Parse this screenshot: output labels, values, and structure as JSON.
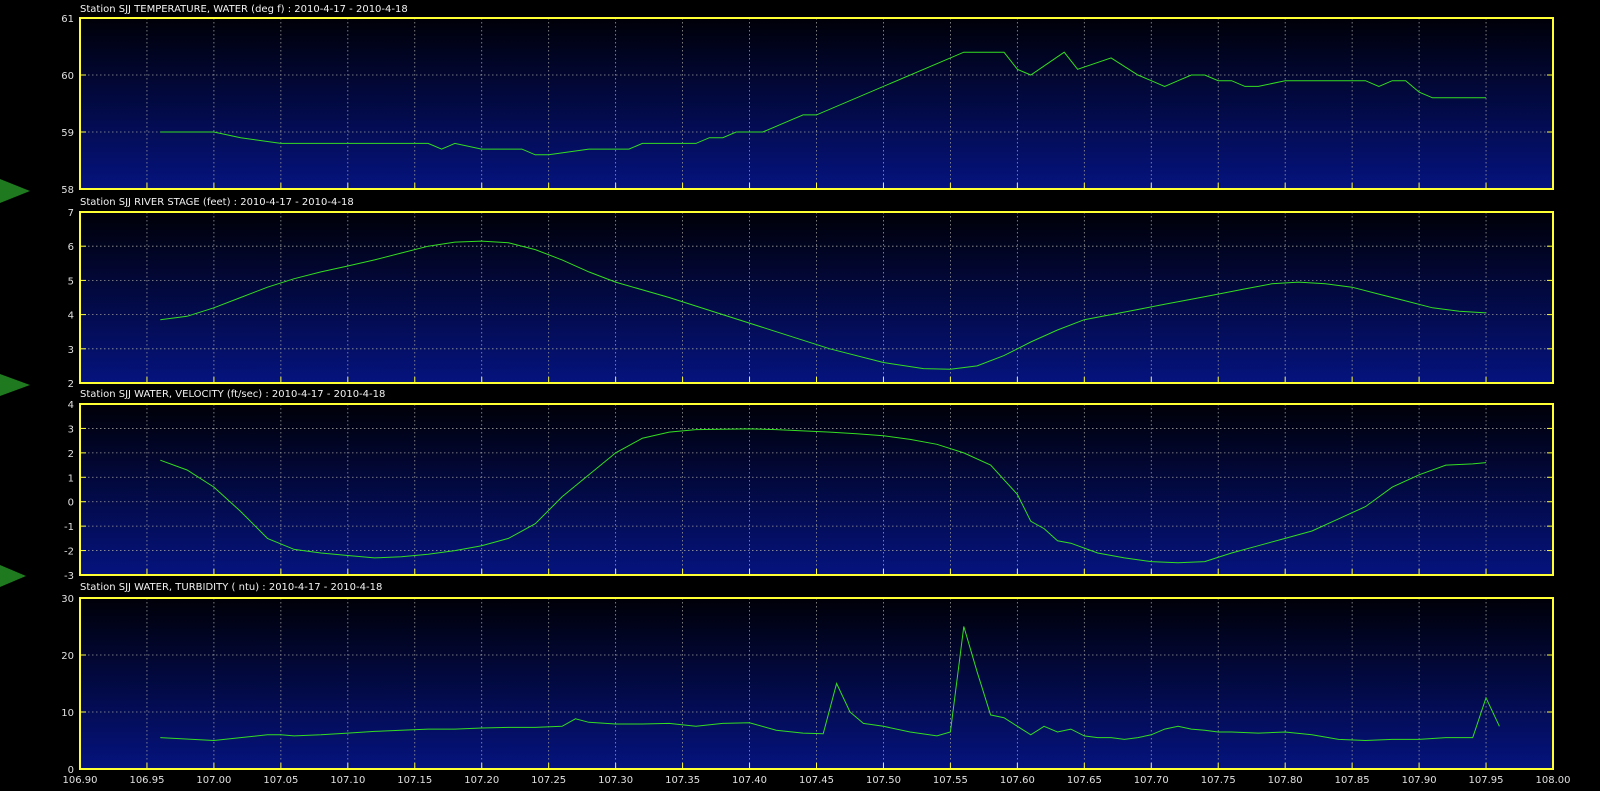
{
  "colors": {
    "background": "#000000",
    "frame": "#ffff33",
    "series": "#33dd22",
    "grid": "#9a9a9a",
    "gradient_top": "#000008",
    "gradient_bottom": "#05137e",
    "marker": "#1f7a1f"
  },
  "chart_data": [
    {
      "type": "line",
      "title": "Station SJJ TEMPERATURE, WATER (deg f) : 2010-4-17 - 2010-4-18",
      "xlim": [
        106.9,
        108.0
      ],
      "ylim": [
        58,
        61
      ],
      "yticks": [
        "58",
        "59",
        "60",
        "61"
      ],
      "grid": true,
      "series": [
        {
          "x": [
            106.96,
            107.0,
            107.02,
            107.05,
            107.1,
            107.15,
            107.16,
            107.17,
            107.175,
            107.18,
            107.2,
            107.22,
            107.23,
            107.24,
            107.25,
            107.28,
            107.3,
            107.31,
            107.32,
            107.35,
            107.36,
            107.37,
            107.38,
            107.39,
            107.4,
            107.41,
            107.43,
            107.44,
            107.45,
            107.55,
            107.56,
            107.59,
            107.6,
            107.61,
            107.635,
            107.645,
            107.67,
            107.69,
            107.7,
            107.71,
            107.72,
            107.73,
            107.74,
            107.75,
            107.76,
            107.77,
            107.78,
            107.8,
            107.85,
            107.86,
            107.87,
            107.88,
            107.89,
            107.9,
            107.91,
            107.92,
            107.95
          ],
          "y": [
            59.0,
            59.0,
            58.9,
            58.8,
            58.8,
            58.8,
            58.8,
            58.7,
            58.75,
            58.8,
            58.7,
            58.7,
            58.7,
            58.6,
            58.6,
            58.7,
            58.7,
            58.7,
            58.8,
            58.8,
            58.8,
            58.9,
            58.9,
            59.0,
            59.0,
            59.0,
            59.2,
            59.3,
            59.3,
            60.3,
            60.4,
            60.4,
            60.1,
            60.0,
            60.4,
            60.1,
            60.3,
            60.0,
            59.9,
            59.8,
            59.9,
            60.0,
            60.0,
            59.9,
            59.9,
            59.8,
            59.8,
            59.9,
            59.9,
            59.9,
            59.8,
            59.9,
            59.9,
            59.7,
            59.6,
            59.6,
            59.6
          ]
        }
      ]
    },
    {
      "type": "line",
      "title": "Station SJJ RIVER STAGE (feet) : 2010-4-17 - 2010-4-18",
      "xlim": [
        106.9,
        108.0
      ],
      "ylim": [
        2,
        7
      ],
      "yticks": [
        "2",
        "3",
        "4",
        "5",
        "6",
        "7"
      ],
      "grid": true,
      "series": [
        {
          "x": [
            106.96,
            106.98,
            107.0,
            107.02,
            107.04,
            107.06,
            107.08,
            107.1,
            107.12,
            107.14,
            107.16,
            107.18,
            107.2,
            107.22,
            107.24,
            107.26,
            107.28,
            107.3,
            107.34,
            107.38,
            107.42,
            107.46,
            107.5,
            107.53,
            107.55,
            107.57,
            107.59,
            107.61,
            107.63,
            107.65,
            107.67,
            107.69,
            107.71,
            107.73,
            107.75,
            107.77,
            107.79,
            107.81,
            107.83,
            107.85,
            107.87,
            107.89,
            107.91,
            107.93,
            107.95
          ],
          "y": [
            3.85,
            3.95,
            4.2,
            4.5,
            4.8,
            5.05,
            5.25,
            5.42,
            5.6,
            5.8,
            6.0,
            6.12,
            6.15,
            6.1,
            5.9,
            5.6,
            5.25,
            4.95,
            4.5,
            4.0,
            3.5,
            3.0,
            2.6,
            2.42,
            2.4,
            2.5,
            2.8,
            3.2,
            3.55,
            3.85,
            4.0,
            4.15,
            4.3,
            4.45,
            4.6,
            4.75,
            4.9,
            4.95,
            4.9,
            4.8,
            4.6,
            4.4,
            4.2,
            4.1,
            4.05
          ]
        }
      ]
    },
    {
      "type": "line",
      "title": "Station SJJ WATER, VELOCITY (ft/sec) : 2010-4-17 - 2010-4-18",
      "xlim": [
        106.9,
        108.0
      ],
      "ylim": [
        -3,
        4
      ],
      "yticks": [
        "-3",
        "-2",
        "-1",
        "0",
        "1",
        "2",
        "3",
        "4"
      ],
      "grid": true,
      "series": [
        {
          "x": [
            106.96,
            106.98,
            107.0,
            107.02,
            107.04,
            107.06,
            107.08,
            107.1,
            107.12,
            107.14,
            107.16,
            107.18,
            107.2,
            107.22,
            107.24,
            107.26,
            107.28,
            107.3,
            107.32,
            107.34,
            107.36,
            107.38,
            107.4,
            107.42,
            107.44,
            107.46,
            107.48,
            107.5,
            107.52,
            107.54,
            107.56,
            107.58,
            107.6,
            107.61,
            107.62,
            107.63,
            107.64,
            107.66,
            107.68,
            107.7,
            107.72,
            107.74,
            107.76,
            107.78,
            107.8,
            107.82,
            107.84,
            107.86,
            107.88,
            107.9,
            107.92,
            107.94,
            107.95
          ],
          "y": [
            1.7,
            1.3,
            0.6,
            -0.4,
            -1.5,
            -1.95,
            -2.1,
            -2.2,
            -2.3,
            -2.25,
            -2.15,
            -2.0,
            -1.8,
            -1.5,
            -0.9,
            0.2,
            1.1,
            2.0,
            2.6,
            2.85,
            2.95,
            2.97,
            2.98,
            2.95,
            2.9,
            2.85,
            2.78,
            2.7,
            2.55,
            2.35,
            2.0,
            1.5,
            0.3,
            -0.8,
            -1.1,
            -1.6,
            -1.7,
            -2.1,
            -2.3,
            -2.45,
            -2.5,
            -2.45,
            -2.1,
            -1.8,
            -1.5,
            -1.2,
            -0.7,
            -0.2,
            0.6,
            1.1,
            1.5,
            1.55,
            1.6
          ]
        }
      ]
    },
    {
      "type": "line",
      "title": "Station SJJ WATER, TURBIDITY ( ntu) : 2010-4-17 - 2010-4-18",
      "xlim": [
        106.9,
        108.0
      ],
      "ylim": [
        0,
        30
      ],
      "yticks": [
        "0",
        "10",
        "20",
        "30"
      ],
      "xticks": [
        "106.90",
        "106.95",
        "107.00",
        "107.05",
        "107.10",
        "107.15",
        "107.20",
        "107.25",
        "107.30",
        "107.35",
        "107.40",
        "107.45",
        "107.50",
        "107.55",
        "107.60",
        "107.65",
        "107.70",
        "107.75",
        "107.80",
        "107.85",
        "107.90",
        "107.95",
        "108.00"
      ],
      "grid": true,
      "series": [
        {
          "x": [
            106.96,
            107.0,
            107.02,
            107.04,
            107.05,
            107.06,
            107.08,
            107.1,
            107.12,
            107.14,
            107.16,
            107.18,
            107.2,
            107.22,
            107.24,
            107.26,
            107.27,
            107.28,
            107.3,
            107.32,
            107.34,
            107.36,
            107.38,
            107.4,
            107.42,
            107.44,
            107.455,
            107.465,
            107.475,
            107.485,
            107.5,
            107.52,
            107.54,
            107.55,
            107.56,
            107.57,
            107.58,
            107.59,
            107.6,
            107.61,
            107.62,
            107.63,
            107.64,
            107.65,
            107.66,
            107.67,
            107.68,
            107.69,
            107.7,
            107.71,
            107.72,
            107.73,
            107.74,
            107.75,
            107.76,
            107.78,
            107.8,
            107.82,
            107.84,
            107.86,
            107.88,
            107.9,
            107.92,
            107.94,
            107.95,
            107.96
          ],
          "y": [
            5.5,
            5.0,
            5.5,
            6.0,
            6.0,
            5.8,
            6.0,
            6.3,
            6.6,
            6.8,
            7.0,
            7.0,
            7.2,
            7.3,
            7.3,
            7.5,
            8.8,
            8.2,
            7.9,
            7.9,
            8.0,
            7.5,
            8.0,
            8.1,
            6.8,
            6.3,
            6.2,
            15.0,
            10.0,
            8.0,
            7.5,
            6.5,
            5.8,
            6.5,
            25.0,
            17.0,
            9.5,
            9.0,
            7.5,
            6.0,
            7.5,
            6.5,
            7.0,
            5.8,
            5.5,
            5.5,
            5.2,
            5.5,
            6.0,
            7.0,
            7.5,
            7.0,
            6.8,
            6.5,
            6.5,
            6.3,
            6.5,
            6.0,
            5.2,
            5.0,
            5.2,
            5.2,
            5.5,
            5.5,
            12.5,
            7.5
          ]
        }
      ]
    }
  ]
}
